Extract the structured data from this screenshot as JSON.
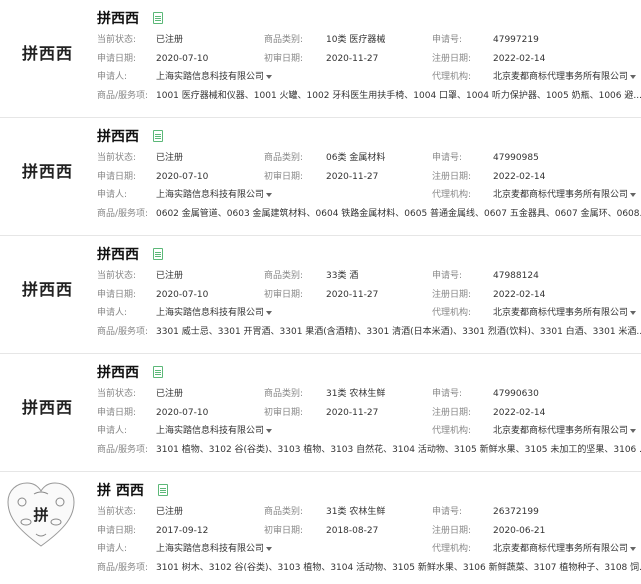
{
  "labels": {
    "status": "当前状态:",
    "category": "商品类别:",
    "reg_no": "申请号:",
    "apply_date": "申请日期:",
    "prelim_date": "初审日期:",
    "reg_date": "注册日期:",
    "applicant": "申请人:",
    "agency": "代理机构:",
    "services": "商品/服务项:"
  },
  "cards": [
    {
      "logo_text": "拼西西",
      "title": "拼西西",
      "status": "已注册",
      "category": "10类 医疗器械",
      "reg_no": "47997219",
      "apply_date": "2020-07-10",
      "prelim_date": "2020-11-27",
      "reg_date": "2022-02-14",
      "applicant": "上海实踏信息科技有限公司",
      "agency": "北京麦都商标代理事务所有限公司",
      "services": "1001 医疗器械和仪器、1001 火罐、1002 牙科医生用扶手椅、1004 口罩、1004 听力保护器、1005 奶瓶、1006 避..."
    },
    {
      "logo_text": "拼西西",
      "title": "拼西西",
      "status": "已注册",
      "category": "06类 金属材料",
      "reg_no": "47990985",
      "apply_date": "2020-07-10",
      "prelim_date": "2020-11-27",
      "reg_date": "2022-02-14",
      "applicant": "上海实踏信息科技有限公司",
      "agency": "北京麦都商标代理事务所有限公司",
      "services": "0602 金属管道、0603 金属建筑材料、0604 铁路金属材料、0605 普通金属线、0607 五金器具、0607 金属环、0608..."
    },
    {
      "logo_text": "拼西西",
      "title": "拼西西",
      "status": "已注册",
      "category": "33类 酒",
      "reg_no": "47988124",
      "apply_date": "2020-07-10",
      "prelim_date": "2020-11-27",
      "reg_date": "2022-02-14",
      "applicant": "上海实踏信息科技有限公司",
      "agency": "北京麦都商标代理事务所有限公司",
      "services": "3301 威士忌、3301 开胃酒、3301 果酒(含酒精)、3301 清酒(日本米酒)、3301 烈酒(饮料)、3301 白酒、3301 米酒..."
    },
    {
      "logo_text": "拼西西",
      "title": "拼西西",
      "status": "已注册",
      "category": "31类 农林生鲜",
      "reg_no": "47990630",
      "apply_date": "2020-07-10",
      "prelim_date": "2020-11-27",
      "reg_date": "2022-02-14",
      "applicant": "上海实踏信息科技有限公司",
      "agency": "北京麦都商标代理事务所有限公司",
      "services": "3101 植物、3102 谷(谷类)、3103 植物、3103 自然花、3104 活动物、3105 新鲜水果、3105 未加工的坚果、3106 ..."
    },
    {
      "logo_text": "拼",
      "title": "拼 西西",
      "status": "已注册",
      "category": "31类 农林生鲜",
      "reg_no": "26372199",
      "apply_date": "2017-09-12",
      "prelim_date": "2018-08-27",
      "reg_date": "2020-06-21",
      "applicant": "上海实踏信息科技有限公司",
      "agency": "北京麦都商标代理事务所有限公司",
      "services": "3101 树木、3102 谷(谷类)、3103 植物、3104 活动物、3105 新鲜水果、3106 新鲜蔬菜、3107 植物种子、3108 饲..."
    }
  ],
  "colors": {
    "label": "#888888",
    "value": "#333333",
    "doc_icon": "#5cb878",
    "divider": "#e6e6e6"
  },
  "icons": {
    "doc": "document-icon",
    "caret": "caret-down-icon",
    "heart": "heart-logo-icon"
  }
}
